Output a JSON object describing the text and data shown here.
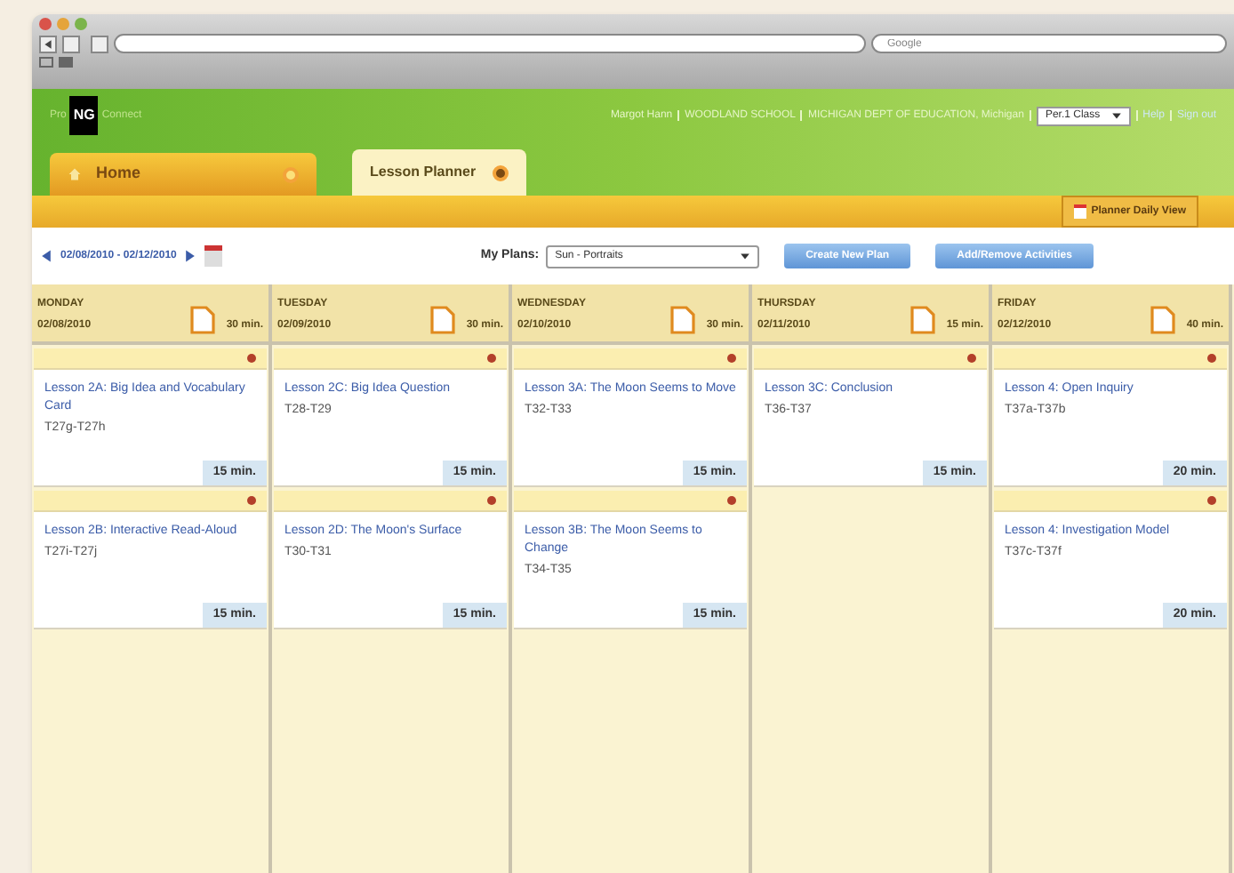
{
  "browser": {
    "search_placeholder": "Google"
  },
  "header": {
    "logo": {
      "prefix": "Pro",
      "mark": "NG",
      "suffix": "Connect"
    },
    "user": "Margot Hann",
    "school": "WOODLAND SCHOOL",
    "district": "MICHIGAN DEPT OF EDUCATION, Michigan",
    "class_select": "Per.1 Class",
    "links": [
      "Help",
      "Sign out"
    ]
  },
  "tabs": [
    {
      "label": "Home",
      "selected": false
    },
    {
      "label": "Lesson Planner",
      "selected": true
    }
  ],
  "daily_view_button": "Planner Daily View",
  "toolbar": {
    "date_range": "02/08/2010 - 02/12/2010",
    "plans_label": "My Plans:",
    "plans_select": "Sun - Portraits",
    "buttons": [
      "Create New Plan",
      "Add/Remove Activities"
    ]
  },
  "days": [
    {
      "name": "MONDAY",
      "date": "02/08/2010",
      "total": "30 min.",
      "lessons": [
        {
          "title": "Lesson 2A: Big Idea and Vocabulary Card",
          "pages": "T27g-T27h",
          "duration": "15 min."
        },
        {
          "title": "Lesson 2B: Interactive Read-Aloud",
          "pages": "T27i-T27j",
          "duration": "15 min."
        }
      ]
    },
    {
      "name": "TUESDAY",
      "date": "02/09/2010",
      "total": "30 min.",
      "lessons": [
        {
          "title": "Lesson 2C: Big Idea Question",
          "pages": "T28-T29",
          "duration": "15 min."
        },
        {
          "title": "Lesson 2D: The Moon's Surface",
          "pages": "T30-T31",
          "duration": "15 min."
        }
      ]
    },
    {
      "name": "WEDNESDAY",
      "date": "02/10/2010",
      "total": "30 min.",
      "lessons": [
        {
          "title": "Lesson 3A: The Moon Seems to Move",
          "pages": "T32-T33",
          "duration": "15 min."
        },
        {
          "title": "Lesson 3B: The Moon Seems to Change",
          "pages": "T34-T35",
          "duration": "15 min."
        }
      ]
    },
    {
      "name": "THURSDAY",
      "date": "02/11/2010",
      "total": "15 min.",
      "lessons": [
        {
          "title": "Lesson 3C: Conclusion",
          "pages": "T36-T37",
          "duration": "15 min."
        }
      ]
    },
    {
      "name": "FRIDAY",
      "date": "02/12/2010",
      "total": "40 min.",
      "lessons": [
        {
          "title": "Lesson 4: Open Inquiry",
          "pages": "T37a-T37b",
          "duration": "20 min."
        },
        {
          "title": "Lesson 4: Investigation Model",
          "pages": "T37c-T37f",
          "duration": "20 min."
        }
      ]
    }
  ]
}
